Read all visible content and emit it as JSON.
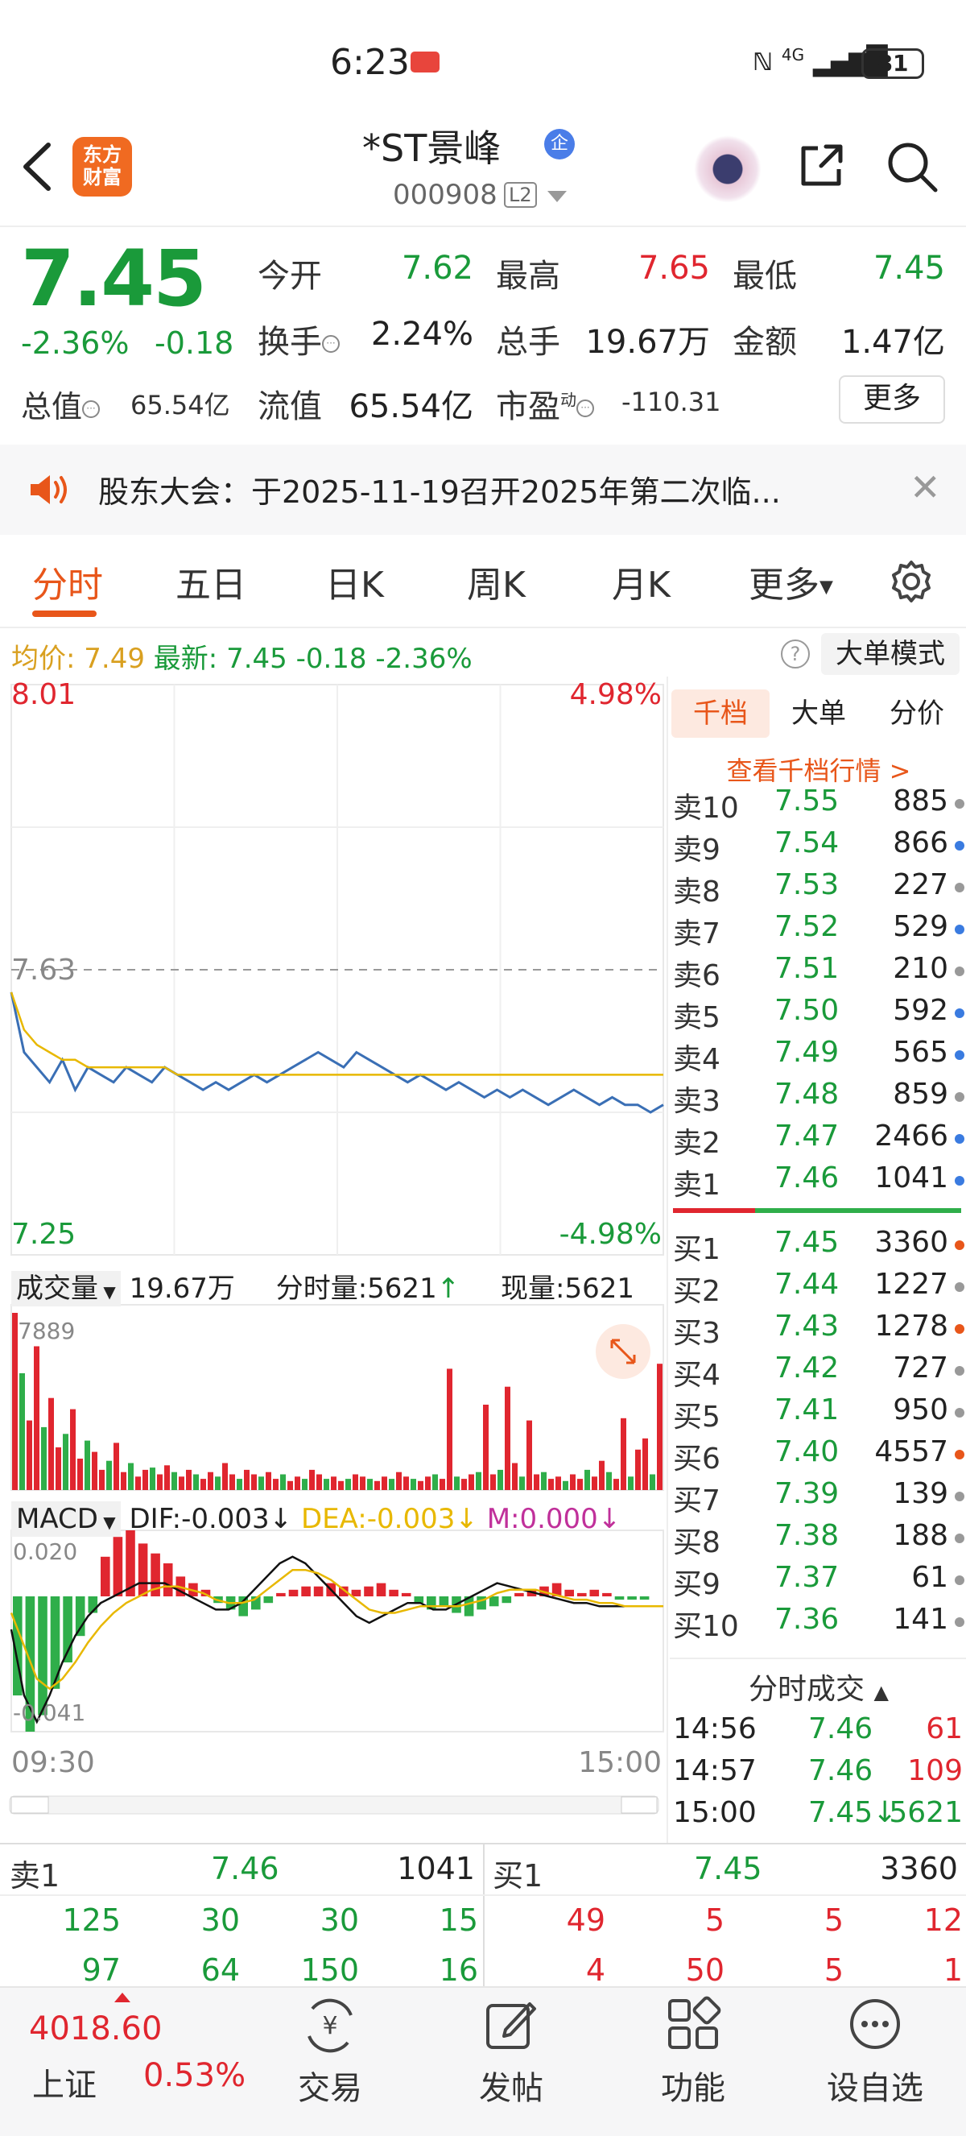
{
  "status_bar": {
    "time": "6:23",
    "network": "4G",
    "battery": "81"
  },
  "header": {
    "title": "*ST景峰",
    "badge": "企",
    "code": "000908",
    "level": "L2",
    "logo_line1": "东方",
    "logo_line2": "财富"
  },
  "quote": {
    "price": "7.45",
    "change_pct": "-2.36%",
    "change": "-0.18",
    "open_label": "今开",
    "open": "7.62",
    "high_label": "最高",
    "high": "7.65",
    "low_label": "最低",
    "low": "7.45",
    "turnover_label": "换手",
    "turnover": "2.24%",
    "volume_label": "总手",
    "volume": "19.67万",
    "amount_label": "金额",
    "amount": "1.47亿",
    "total_cap_label": "总值",
    "total_cap": "65.54亿",
    "float_cap_label": "流值",
    "float_cap": "65.54亿",
    "pe_label": "市盈",
    "pe_superscript": "动",
    "pe": "-110.31",
    "more_button": "更多"
  },
  "notice": {
    "text": "股东大会：于2025-11-19召开2025年第二次临..."
  },
  "tabs": [
    {
      "label": "分时",
      "active": true
    },
    {
      "label": "五日"
    },
    {
      "label": "日K"
    },
    {
      "label": "周K"
    },
    {
      "label": "月K"
    },
    {
      "label": "更多"
    }
  ],
  "info_line": {
    "avg_label": "均价:",
    "avg": "7.49",
    "latest_label": "最新:",
    "latest": "7.45",
    "change": "-0.18",
    "change_pct": "-2.36%",
    "mode_button": "大单模式"
  },
  "chart_data": {
    "type": "line",
    "price_axis": {
      "top": "8.01",
      "mid": "7.63",
      "bottom": "7.25",
      "top_pct": "4.98%",
      "bottom_pct": "-4.98%"
    },
    "ylim": [
      7.25,
      8.01
    ],
    "time_labels": [
      "09:30",
      "15:00"
    ],
    "series": [
      {
        "values": [
          7.6,
          7.52,
          7.5,
          7.48,
          7.51,
          7.47,
          7.5,
          7.49,
          7.48,
          7.5,
          7.49,
          7.48,
          7.5,
          7.49,
          7.48,
          7.47,
          7.48,
          7.47,
          7.48,
          7.49,
          7.48,
          7.49,
          7.5,
          7.51,
          7.52,
          7.51,
          7.5,
          7.52,
          7.51,
          7.5,
          7.49,
          7.48,
          7.49,
          7.48,
          7.47,
          7.48,
          7.47,
          7.46,
          7.47,
          7.46,
          7.47,
          7.46,
          7.45,
          7.46,
          7.47,
          7.46,
          7.45,
          7.46,
          7.45,
          7.45,
          7.44,
          7.45
        ]
      },
      {
        "values": [
          7.6,
          7.55,
          7.53,
          7.52,
          7.51,
          7.51,
          7.5,
          7.5,
          7.5,
          7.5,
          7.5,
          7.5,
          7.5,
          7.49,
          7.49,
          7.49,
          7.49,
          7.49,
          7.49,
          7.49,
          7.49,
          7.49,
          7.49,
          7.49,
          7.49,
          7.49,
          7.49,
          7.49,
          7.49,
          7.49,
          7.49,
          7.49,
          7.49,
          7.49,
          7.49,
          7.49,
          7.49,
          7.49,
          7.49,
          7.49,
          7.49,
          7.49,
          7.49,
          7.49,
          7.49,
          7.49,
          7.49,
          7.49,
          7.49,
          7.49,
          7.49,
          7.49
        ]
      }
    ],
    "volume": {
      "label": "成交量",
      "total": "19.67万",
      "tick_label": "分时量:5621",
      "now_label": "现量:5621",
      "max_label": "7889",
      "bars": [
        7889,
        5200,
        3100,
        6400,
        2800,
        4100,
        1900,
        2500,
        3600,
        1400,
        2200,
        1700,
        900,
        1300,
        2100,
        800,
        1200,
        600,
        900,
        1000,
        700,
        1100,
        800,
        600,
        900,
        700,
        500,
        800,
        600,
        1200,
        700,
        500,
        900,
        700,
        600,
        800,
        500,
        700,
        400,
        600,
        500,
        900,
        700,
        500,
        600,
        400,
        500,
        700,
        600,
        500,
        400,
        600,
        500,
        800,
        600,
        500,
        400,
        600,
        700,
        500,
        5400,
        600,
        500,
        700,
        800,
        3800,
        700,
        900,
        4600,
        1200,
        600,
        3100,
        700,
        800,
        500,
        600,
        400,
        700,
        500,
        900,
        600,
        1300,
        800,
        500,
        3200,
        600,
        1800,
        2300,
        700,
        5621
      ]
    },
    "macd": {
      "label": "MACD",
      "dif": "DIF:-0.003",
      "dea": "DEA:-0.003",
      "m": "M:0.000",
      "top": "0.020",
      "bottom": "-0.041",
      "hist": [
        -0.03,
        -0.041,
        -0.036,
        -0.028,
        -0.02,
        -0.012,
        -0.005,
        0.012,
        0.018,
        0.02,
        0.016,
        0.013,
        0.01,
        0.006,
        0.004,
        0.002,
        -0.002,
        -0.004,
        -0.006,
        -0.004,
        -0.002,
        0.001,
        0.002,
        0.003,
        0.003,
        0.004,
        0.003,
        0.002,
        0.003,
        0.004,
        0.002,
        0.001,
        -0.002,
        -0.004,
        -0.003,
        -0.005,
        -0.006,
        -0.004,
        -0.003,
        -0.002,
        0.001,
        0.002,
        0.003,
        0.004,
        0.002,
        0.001,
        0.002,
        0.001,
        -0.001,
        -0.001,
        -0.001,
        0.0
      ],
      "dif_line": [
        -0.01,
        -0.03,
        -0.038,
        -0.03,
        -0.02,
        -0.012,
        -0.006,
        -0.002,
        0.0,
        0.002,
        0.004,
        0.004,
        0.004,
        0.002,
        0.0,
        -0.002,
        -0.004,
        -0.004,
        -0.002,
        0.002,
        0.006,
        0.01,
        0.012,
        0.01,
        0.006,
        0.002,
        -0.002,
        -0.006,
        -0.008,
        -0.006,
        -0.004,
        -0.002,
        -0.002,
        -0.004,
        -0.004,
        -0.002,
        0.0,
        0.002,
        0.004,
        0.003,
        0.002,
        0.001,
        0.0,
        -0.001,
        -0.002,
        -0.002,
        -0.003,
        -0.003,
        -0.003,
        -0.003,
        -0.003,
        -0.003
      ],
      "dea_line": [
        -0.005,
        -0.015,
        -0.025,
        -0.028,
        -0.025,
        -0.02,
        -0.014,
        -0.009,
        -0.005,
        -0.002,
        0.0,
        0.002,
        0.003,
        0.003,
        0.002,
        0.001,
        -0.001,
        -0.002,
        -0.002,
        -0.001,
        0.002,
        0.005,
        0.008,
        0.008,
        0.007,
        0.005,
        0.002,
        -0.001,
        -0.004,
        -0.005,
        -0.005,
        -0.004,
        -0.003,
        -0.003,
        -0.003,
        -0.003,
        -0.002,
        -0.001,
        0.001,
        0.002,
        0.002,
        0.002,
        0.001,
        0.0,
        -0.001,
        -0.001,
        -0.002,
        -0.002,
        -0.003,
        -0.003,
        -0.003,
        -0.003
      ]
    }
  },
  "order_book": {
    "tabs": [
      "千档",
      "大单",
      "分价"
    ],
    "link": "查看千档行情 >",
    "asks": [
      {
        "label": "卖10",
        "price": "7.55",
        "vol": "885",
        "dot": "#999999"
      },
      {
        "label": "卖9",
        "price": "7.54",
        "vol": "866",
        "dot": "#3a7be0"
      },
      {
        "label": "卖8",
        "price": "7.53",
        "vol": "227",
        "dot": "#999999"
      },
      {
        "label": "卖7",
        "price": "7.52",
        "vol": "529",
        "dot": "#3a7be0"
      },
      {
        "label": "卖6",
        "price": "7.51",
        "vol": "210",
        "dot": "#999999"
      },
      {
        "label": "卖5",
        "price": "7.50",
        "vol": "592",
        "dot": "#3a7be0"
      },
      {
        "label": "卖4",
        "price": "7.49",
        "vol": "565",
        "dot": "#3a7be0"
      },
      {
        "label": "卖3",
        "price": "7.48",
        "vol": "859",
        "dot": "#999999"
      },
      {
        "label": "卖2",
        "price": "7.47",
        "vol": "2466",
        "dot": "#3a7be0"
      },
      {
        "label": "卖1",
        "price": "7.46",
        "vol": "1041",
        "dot": "#3a7be0"
      }
    ],
    "bids": [
      {
        "label": "买1",
        "price": "7.45",
        "vol": "3360",
        "dot": "#e8561a"
      },
      {
        "label": "买2",
        "price": "7.44",
        "vol": "1227",
        "dot": "#999999"
      },
      {
        "label": "买3",
        "price": "7.43",
        "vol": "1278",
        "dot": "#e8561a"
      },
      {
        "label": "买4",
        "price": "7.42",
        "vol": "727",
        "dot": "#999999"
      },
      {
        "label": "买5",
        "price": "7.41",
        "vol": "950",
        "dot": "#999999"
      },
      {
        "label": "买6",
        "price": "7.40",
        "vol": "4557",
        "dot": "#e8561a"
      },
      {
        "label": "买7",
        "price": "7.39",
        "vol": "139",
        "dot": "#999999"
      },
      {
        "label": "买8",
        "price": "7.38",
        "vol": "188",
        "dot": "#999999"
      },
      {
        "label": "买9",
        "price": "7.37",
        "vol": "61",
        "dot": "#999999"
      },
      {
        "label": "买10",
        "price": "7.36",
        "vol": "141",
        "dot": "#999999"
      }
    ],
    "ticks_title": "分时成交",
    "ticks": [
      {
        "time": "14:56",
        "price": "7.46",
        "vol": "61",
        "color": "#e0262f"
      },
      {
        "time": "14:57",
        "price": "7.46",
        "vol": "109",
        "color": "#e0262f"
      },
      {
        "time": "15:00",
        "price": "7.45↓",
        "vol": "5621",
        "color": "#1a9a3a"
      }
    ]
  },
  "bottom_books": {
    "sell": {
      "label": "卖1",
      "price": "7.46",
      "vol": "1041",
      "row1": [
        "125",
        "30",
        "30",
        "15"
      ],
      "row2": [
        "97",
        "64",
        "150",
        "16"
      ]
    },
    "buy": {
      "label": "买1",
      "price": "7.45",
      "vol": "3360",
      "row1": [
        "49",
        "5",
        "5",
        "12"
      ],
      "row2": [
        "4",
        "50",
        "5",
        "1"
      ]
    }
  },
  "bottom_nav": {
    "index_value": "4018.60",
    "index_name": "上证",
    "index_pct": "0.53%",
    "items": [
      {
        "label": "交易"
      },
      {
        "label": "发帖"
      },
      {
        "label": "功能"
      },
      {
        "label": "设自选"
      }
    ]
  }
}
